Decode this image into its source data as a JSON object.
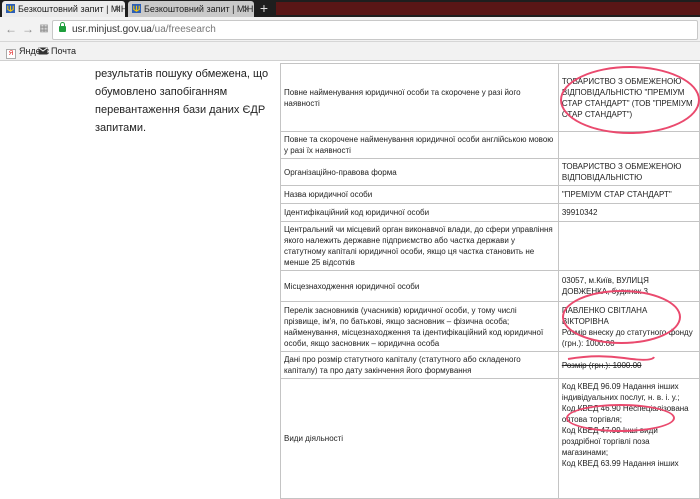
{
  "browser": {
    "tabs": [
      {
        "label": "Безкоштовний запит | МІН",
        "active": true
      },
      {
        "label": "Безкоштовний запит | МІН",
        "active": false
      }
    ],
    "new_tab_symbol": "+",
    "url_host": "usr.minjust.gov.ua",
    "url_path": "/ua/freesearch",
    "bookmarks": [
      {
        "label": "Яндекс",
        "icon": "yandex-icon"
      },
      {
        "label": "Почта",
        "icon": "mail-icon"
      }
    ]
  },
  "page": {
    "notice_text": "результатів пошуку обмежена, що обумовлено запобіганням перевантаження бази даних ЄДР запитами.",
    "rows": [
      {
        "label": "Повне найменування юридичної особи та скорочене у разі його наявності",
        "value": [
          "ТОВАРИСТВО З ОБМЕЖЕНОЮ ВІДПОВІДАЛЬНІСТЮ \"ПРЕМІУМ СТАР СТАНДАРТ\" (ТОВ \"ПРЕМІУМ СТАР СТАНДАРТ\")"
        ]
      },
      {
        "label": "Повне та скорочене найменування юридичної особи англійською мовою у разі їх наявності",
        "value": [
          ""
        ]
      },
      {
        "label": "Організаційно-правова форма",
        "value": [
          "ТОВАРИСТВО З ОБМЕЖЕНОЮ ВІДПОВІДАЛЬНІСТЮ"
        ]
      },
      {
        "label": "Назва юридичної особи",
        "value": [
          "\"ПРЕМІУМ СТАР СТАНДАРТ\""
        ]
      },
      {
        "label": "Ідентифікаційний код юридичної особи",
        "value": [
          "39910342"
        ]
      },
      {
        "label": "Центральний чи місцевий орган виконавчої влади, до сфери управління якого належить державне підприємство або частка держави у статутному капіталі юридичної особи, якщо ця частка становить не менше 25 відсотків",
        "value": [
          ""
        ]
      },
      {
        "label": "Місцезнаходження юридичної особи",
        "value": [
          "03057, м.Київ, ВУЛИЦЯ ДОВЖЕНКА, будинок 3"
        ]
      },
      {
        "label": "Перелік засновників (учасників) юридичної особи, у тому числі прізвище, ім'я, по батькові, якщо засновник – фізична особа; найменування, місцезнаходження та ідентифікаційний код юридичної особи, якщо засновник – юридична особа",
        "value": [
          "ПАВЛЕНКО СВІТЛАНА ВІКТОРІВНА",
          "Розмір внеску до статутного фонду (грн.): 1000.00"
        ]
      },
      {
        "label": "Дані про розмір статутного капіталу (статутного або складеного капіталу) та про дату закінчення його формування",
        "value": [
          "Розмір (грн.): 1000.00"
        ]
      },
      {
        "label": "Види діяльності",
        "value": [
          "Код КВЕД 96.09 Надання інших індивідуальних послуг, н. в. і. у.;",
          "Код КВЕД 46.90 Неспеціалізована оптова торгівля;",
          "Код КВЕД 47.99 Інші види роздрібної торгівлі поза магазинами;",
          "Код КВЕД 63.99 Надання інших"
        ]
      }
    ]
  },
  "colors": {
    "annotation_red": "#ea4a6e",
    "tabbar_bg": "#1e1e1e",
    "secure_green": "#1e9e3c"
  }
}
